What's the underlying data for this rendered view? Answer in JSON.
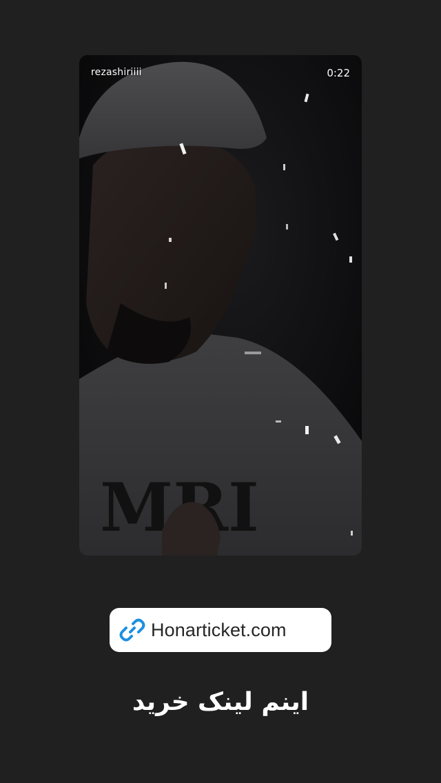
{
  "story": {
    "username": "rezashiriiii",
    "timer": "0:22"
  },
  "link_sticker": {
    "icon": "link-icon",
    "text": "Honarticket.com",
    "icon_color": "#1d8fe1"
  },
  "caption": {
    "text": "اینم لینک خرید"
  },
  "colors": {
    "background": "#202020",
    "sticker_background": "#ffffff"
  }
}
